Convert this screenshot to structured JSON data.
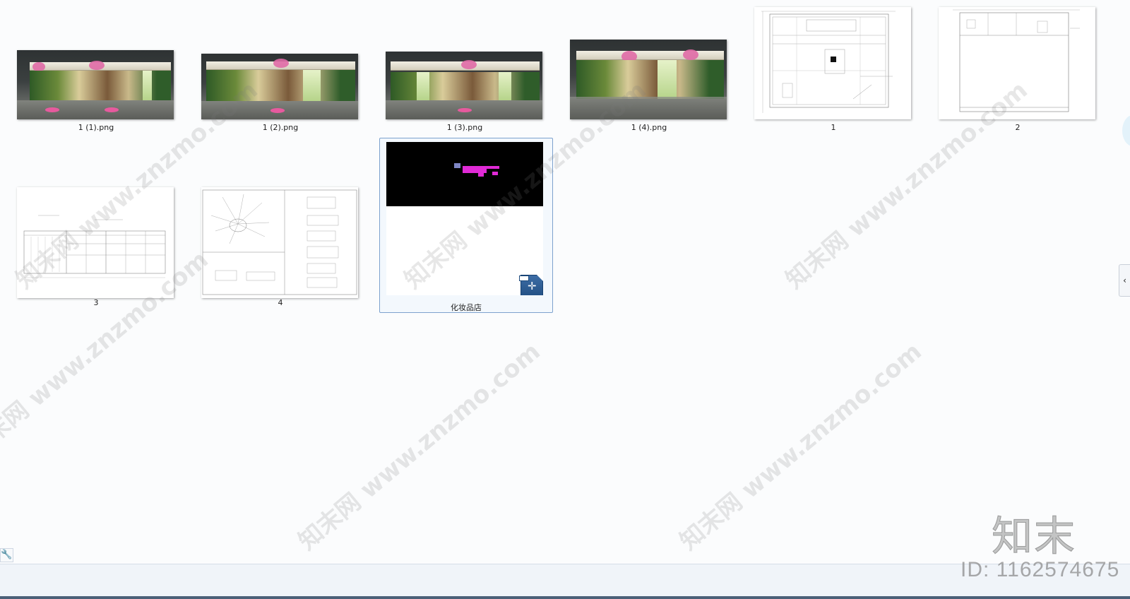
{
  "files": [
    {
      "name": "1 (1).png",
      "kind": "render"
    },
    {
      "name": "1 (2).png",
      "kind": "render"
    },
    {
      "name": "1 (3).png",
      "kind": "render"
    },
    {
      "name": "1 (4).png",
      "kind": "render"
    },
    {
      "name": "1",
      "kind": "drawing"
    },
    {
      "name": "2",
      "kind": "drawing"
    },
    {
      "name": "3",
      "kind": "drawing"
    },
    {
      "name": "4",
      "kind": "drawing"
    },
    {
      "name": "化妆品店",
      "kind": "cad",
      "selected": true
    }
  ],
  "watermark": {
    "text": "知末网 www.znzmo.com",
    "logo": "知末",
    "id_text": "ID: 1162574675"
  },
  "panel": {
    "collapse_glyph": "‹"
  },
  "statusbar": {
    "wrench_glyph": "🔧"
  },
  "colors": {
    "background": "#fbfcfd",
    "selection_border": "#7da2ce",
    "statusbar": "#f0f4f9",
    "cad_accent": "#e02ad6"
  }
}
